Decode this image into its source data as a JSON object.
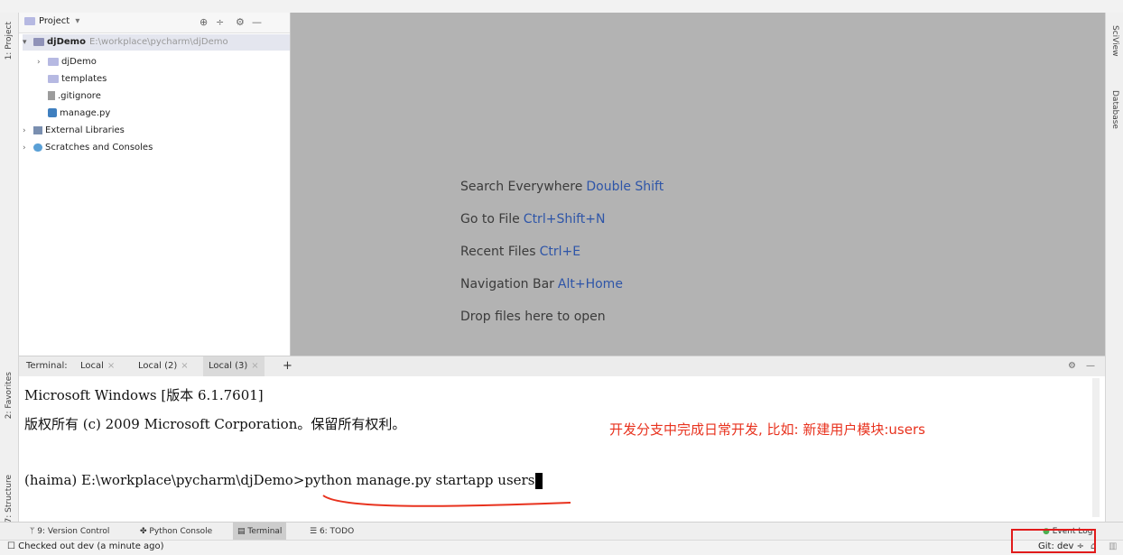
{
  "project_panel": {
    "title": "Project",
    "tree": [
      {
        "label": "djDemo",
        "path": "E:\\workplace\\pycharm\\djDemo"
      },
      {
        "label": "djDemo"
      },
      {
        "label": "templates"
      },
      {
        "label": ".gitignore"
      },
      {
        "label": "manage.py"
      },
      {
        "label": "External Libraries"
      },
      {
        "label": "Scratches and Consoles"
      }
    ]
  },
  "left_strip": {
    "project_tab": "1: Project",
    "favorites_tab": "2: Favorites",
    "structure_tab": "7: Structure"
  },
  "right_strip": {
    "sciview_tab": "SciView",
    "database_tab": "Database"
  },
  "editor_hints": [
    {
      "text": "Search Everywhere",
      "key": "Double Shift"
    },
    {
      "text": "Go to File",
      "key": "Ctrl+Shift+N"
    },
    {
      "text": "Recent Files",
      "key": "Ctrl+E"
    },
    {
      "text": "Navigation Bar",
      "key": "Alt+Home"
    },
    {
      "text": "Drop files here to open",
      "key": ""
    }
  ],
  "terminal": {
    "label": "Terminal:",
    "tabs": [
      "Local",
      "Local (2)",
      "Local (3)"
    ],
    "add": "+",
    "lines": [
      "Microsoft Windows [版本 6.1.7601]",
      "版权所有 (c) 2009 Microsoft Corporation。保留所有权利。"
    ],
    "prompt": "(haima) E:\\workplace\\pycharm\\djDemo>",
    "command": "python manage.py startapp users"
  },
  "annotation": "开发分支中完成日常开发, 比如: 新建用户模块:users",
  "bottom_tools": [
    {
      "label": "9: Version Control"
    },
    {
      "label": "Python Console"
    },
    {
      "label": "Terminal"
    },
    {
      "label": "6: TODO"
    }
  ],
  "event_log": "Event Log",
  "status": {
    "message": "Checked out dev (a minute ago)",
    "git": "Git: dev"
  },
  "colors": {
    "accent_key": "#2e55a8",
    "annotation": "#e8321e",
    "highlight_box": "#e11b1b",
    "editor_bg": "#b3b3b3"
  }
}
